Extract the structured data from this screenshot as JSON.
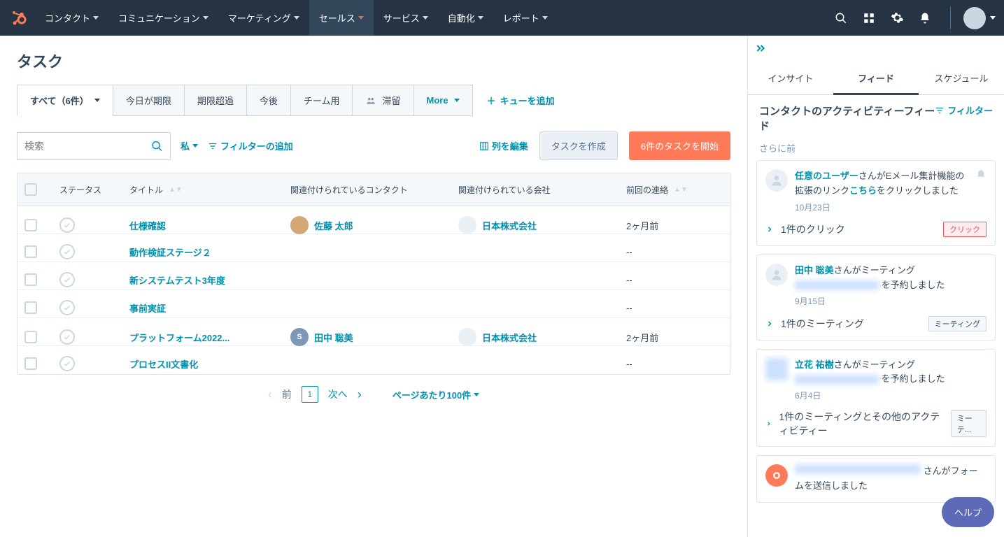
{
  "nav": {
    "items": [
      {
        "label": "コンタクト"
      },
      {
        "label": "コミュニケーション"
      },
      {
        "label": "マーケティング"
      },
      {
        "label": "セールス",
        "active": true
      },
      {
        "label": "サービス"
      },
      {
        "label": "自動化"
      },
      {
        "label": "レポート"
      }
    ]
  },
  "page": {
    "title": "タスク"
  },
  "tabs": {
    "items": [
      {
        "label": "すべて（6件）",
        "active": true,
        "dropdown": true
      },
      {
        "label": "今日が期限"
      },
      {
        "label": "期限超過"
      },
      {
        "label": "今後"
      },
      {
        "label": "チーム用"
      },
      {
        "label": "滞留",
        "icon": true
      },
      {
        "label": "More",
        "more": true
      }
    ],
    "add_queue": "キューを追加"
  },
  "filters": {
    "search_placeholder": "検索",
    "me": "私",
    "add_filter": "フィルターの追加",
    "edit_columns": "列を編集",
    "create_task": "タスクを作成",
    "start_tasks": "6件のタスクを開始"
  },
  "table": {
    "headers": {
      "status": "ステータス",
      "title": "タイトル",
      "contact": "関連付けられているコンタクト",
      "company": "関連付けられている会社",
      "last": "前回の連絡"
    },
    "rows": [
      {
        "title": "仕様確認",
        "contact": "佐藤 太郎",
        "company": "日本株式会社",
        "last": "2ヶ月前",
        "avatar": "photo"
      },
      {
        "title": "動作検証ステージ２",
        "contact": "",
        "company": "",
        "last": "--"
      },
      {
        "title": "新システムテスト3年度",
        "contact": "",
        "company": "",
        "last": "--"
      },
      {
        "title": "事前実証",
        "contact": "",
        "company": "",
        "last": "--"
      },
      {
        "title": "プラットフォーム2022...",
        "contact": "田中 聡美",
        "company": "日本株式会社",
        "last": "2ヶ月前",
        "avatar": "S",
        "avatar_bg": "#7c98b6"
      },
      {
        "title": "プロセスII文書化",
        "contact": "",
        "company": "",
        "last": "--"
      }
    ]
  },
  "pagination": {
    "prev": "前",
    "page": "1",
    "next": "次へ",
    "per_page": "ページあたり100件"
  },
  "sidebar": {
    "tabs": [
      "インサイト",
      "フィード",
      "スケジュール"
    ],
    "active_tab": 1,
    "title": "コンタクトのアクティビティーフィード",
    "filter": "フィルター",
    "subtitle": "さらに前",
    "cards": [
      {
        "user": "任意のユーザー",
        "text1": "さんがEメール集計機能の拡張のリンク",
        "link": "こちら",
        "text2": "をクリックしました",
        "date": "10月23日",
        "footer": "1件のクリック",
        "badge": "クリック",
        "badge_type": "click",
        "bell": true
      },
      {
        "user": "田中 聡美",
        "text1": "さんがミーティング",
        "blurred": true,
        "text2": "を予約しました",
        "date": "9月15日",
        "footer": "1件のミーティング",
        "badge": "ミーティング"
      },
      {
        "user": "立花 祐樹",
        "text1": "さんがミーティング",
        "blurred": true,
        "text2": "を予約しました",
        "date": "6月4日",
        "footer": "1件のミーティングとその他のアクティビティー",
        "badge": "ミーテ...",
        "blur_avatar": true
      },
      {
        "blurred_all": true,
        "text2": "さんがフォームを送信しました",
        "hubspot_avatar": true
      }
    ]
  },
  "help": "ヘルプ"
}
